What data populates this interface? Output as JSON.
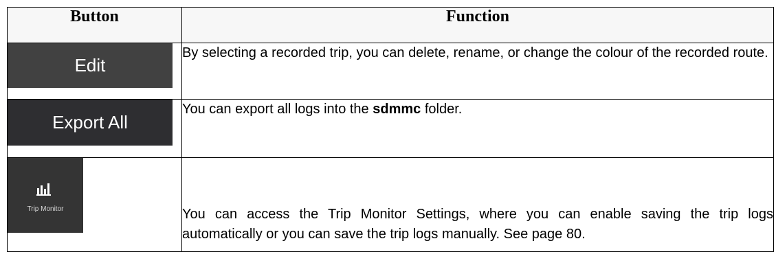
{
  "headers": {
    "button": "Button",
    "function": "Function"
  },
  "rows": [
    {
      "button_label": "Edit",
      "description": "By selecting a recorded trip, you can delete, rename, or change the colour of the recorded route."
    },
    {
      "button_label": "Export All",
      "description_pre": "You can export all logs into the ",
      "description_bold": "sdmmc",
      "description_post": " folder."
    },
    {
      "button_label": "Trip Monitor",
      "button_icon": "bar-chart-icon",
      "description": "You can access the Trip Monitor Settings, where you can enable saving the trip logs automatically or you can save the trip logs manually. See page 80."
    }
  ],
  "colors": {
    "button_bg": "#3c3c3c",
    "button_text": "#ffffff",
    "header_bg": "#f7f7f7",
    "border": "#000000"
  }
}
